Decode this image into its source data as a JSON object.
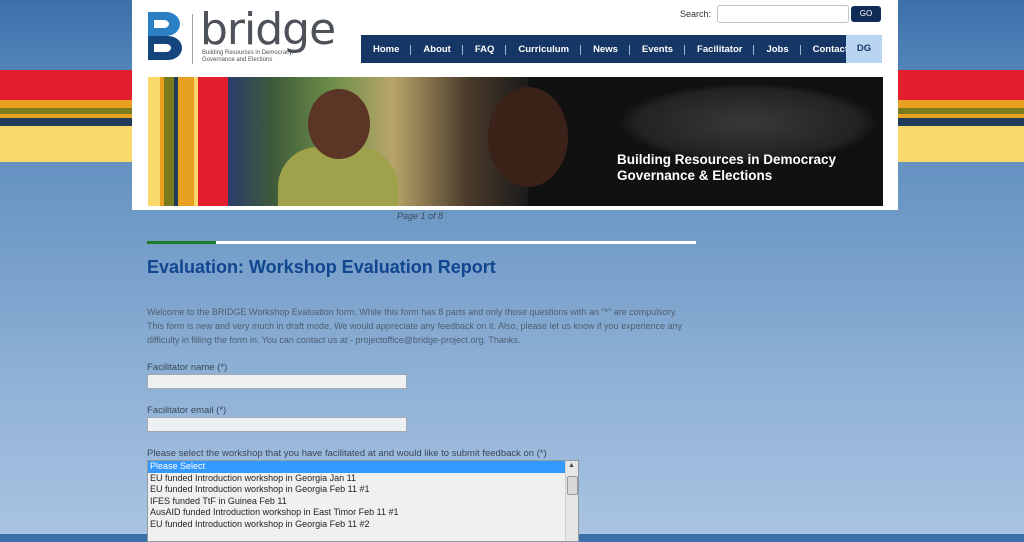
{
  "site": {
    "logo_text": "bridge",
    "logo_tagline": "Building Resources in Democracy, Governance and Elections"
  },
  "search": {
    "label": "Search:",
    "value": "",
    "button": "GO"
  },
  "nav": {
    "items": [
      "Home",
      "About",
      "FAQ",
      "Curriculum",
      "News",
      "Events",
      "Facilitator",
      "Jobs",
      "Contact"
    ],
    "active_item": "DG"
  },
  "banner": {
    "caption_line1": "Building Resources in Democracy",
    "caption_line2": "Governance & Elections"
  },
  "pager": "Page 1 of 8",
  "progress": {
    "fraction": 0.125,
    "fill_color": "#1f7a2a"
  },
  "page_title": "Evaluation: Workshop Evaluation Report",
  "intro": "Welcome to the BRIDGE Workshop Evaluation form. While this form has 8 parts and only those questions with an \"*\" are compulsory. This form is new and very much in draft mode. We would appreciate any feedback on it. Also, please let us know if you experience any difficulty in filling the form in. You can contact us at - projectoffice@bridge-project.org. Thanks.",
  "form": {
    "facilitator_name_label": "Facilitator name (*)",
    "facilitator_name_value": "",
    "facilitator_email_label": "Facilitator email (*)",
    "facilitator_email_value": "",
    "workshop_label": "Please select the workshop that you have facilitated at and would like to submit feedback on (*)",
    "workshop_options": [
      "Please Select",
      "EU funded Introduction workshop in Georgia Jan 11",
      "EU funded Introduction workshop in Georgia Feb 11 #1",
      "IFES funded TtF in Guinea Feb 11",
      "AusAID funded Introduction workshop in East Timor Feb 11 #1",
      "EU funded Introduction workshop in Georgia Feb 11 #2"
    ],
    "workshop_selected_index": 0
  },
  "colors": {
    "nav_bg": "#163766",
    "title": "#10458f",
    "stripe_red": "#e31e2d",
    "stripe_yellow": "#fbd86a"
  }
}
